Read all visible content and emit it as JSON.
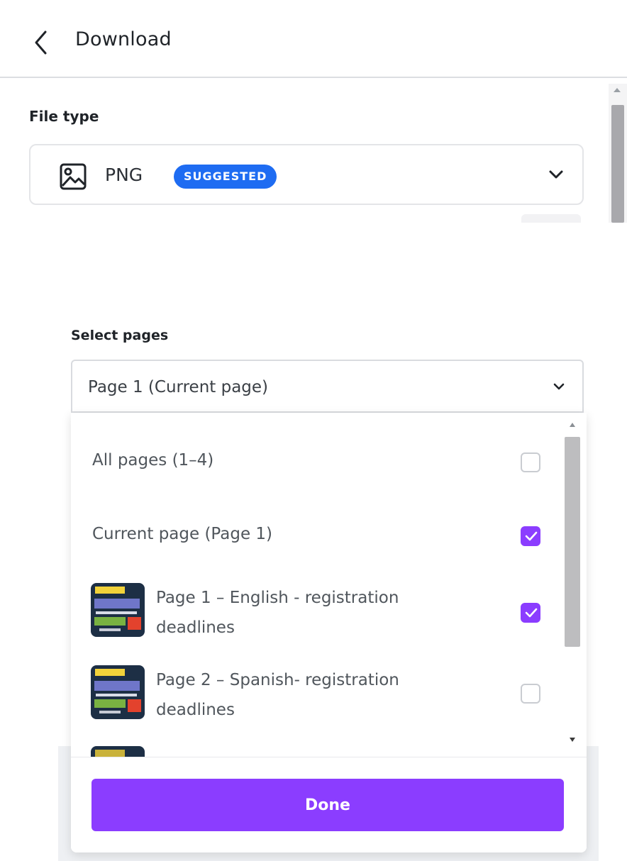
{
  "header": {
    "title": "Download"
  },
  "file_type": {
    "label": "File type",
    "value": "PNG",
    "badge": "SUGGESTED",
    "icon": "image-icon"
  },
  "select_pages": {
    "label": "Select pages",
    "value": "Page 1 (Current page)",
    "options": [
      {
        "label": "All pages (1–4)",
        "checked": false
      },
      {
        "label": "Current page (Page 1)",
        "checked": true
      },
      {
        "label": "Page 1 – English - registration deadlines",
        "checked": true,
        "thumbnail": true
      },
      {
        "label": "Page 2 – Spanish- registration deadlines",
        "checked": false,
        "thumbnail": true
      }
    ]
  },
  "done_label": "Done",
  "colors": {
    "accent": "#8b3dff",
    "badge": "#1e6cf2"
  }
}
